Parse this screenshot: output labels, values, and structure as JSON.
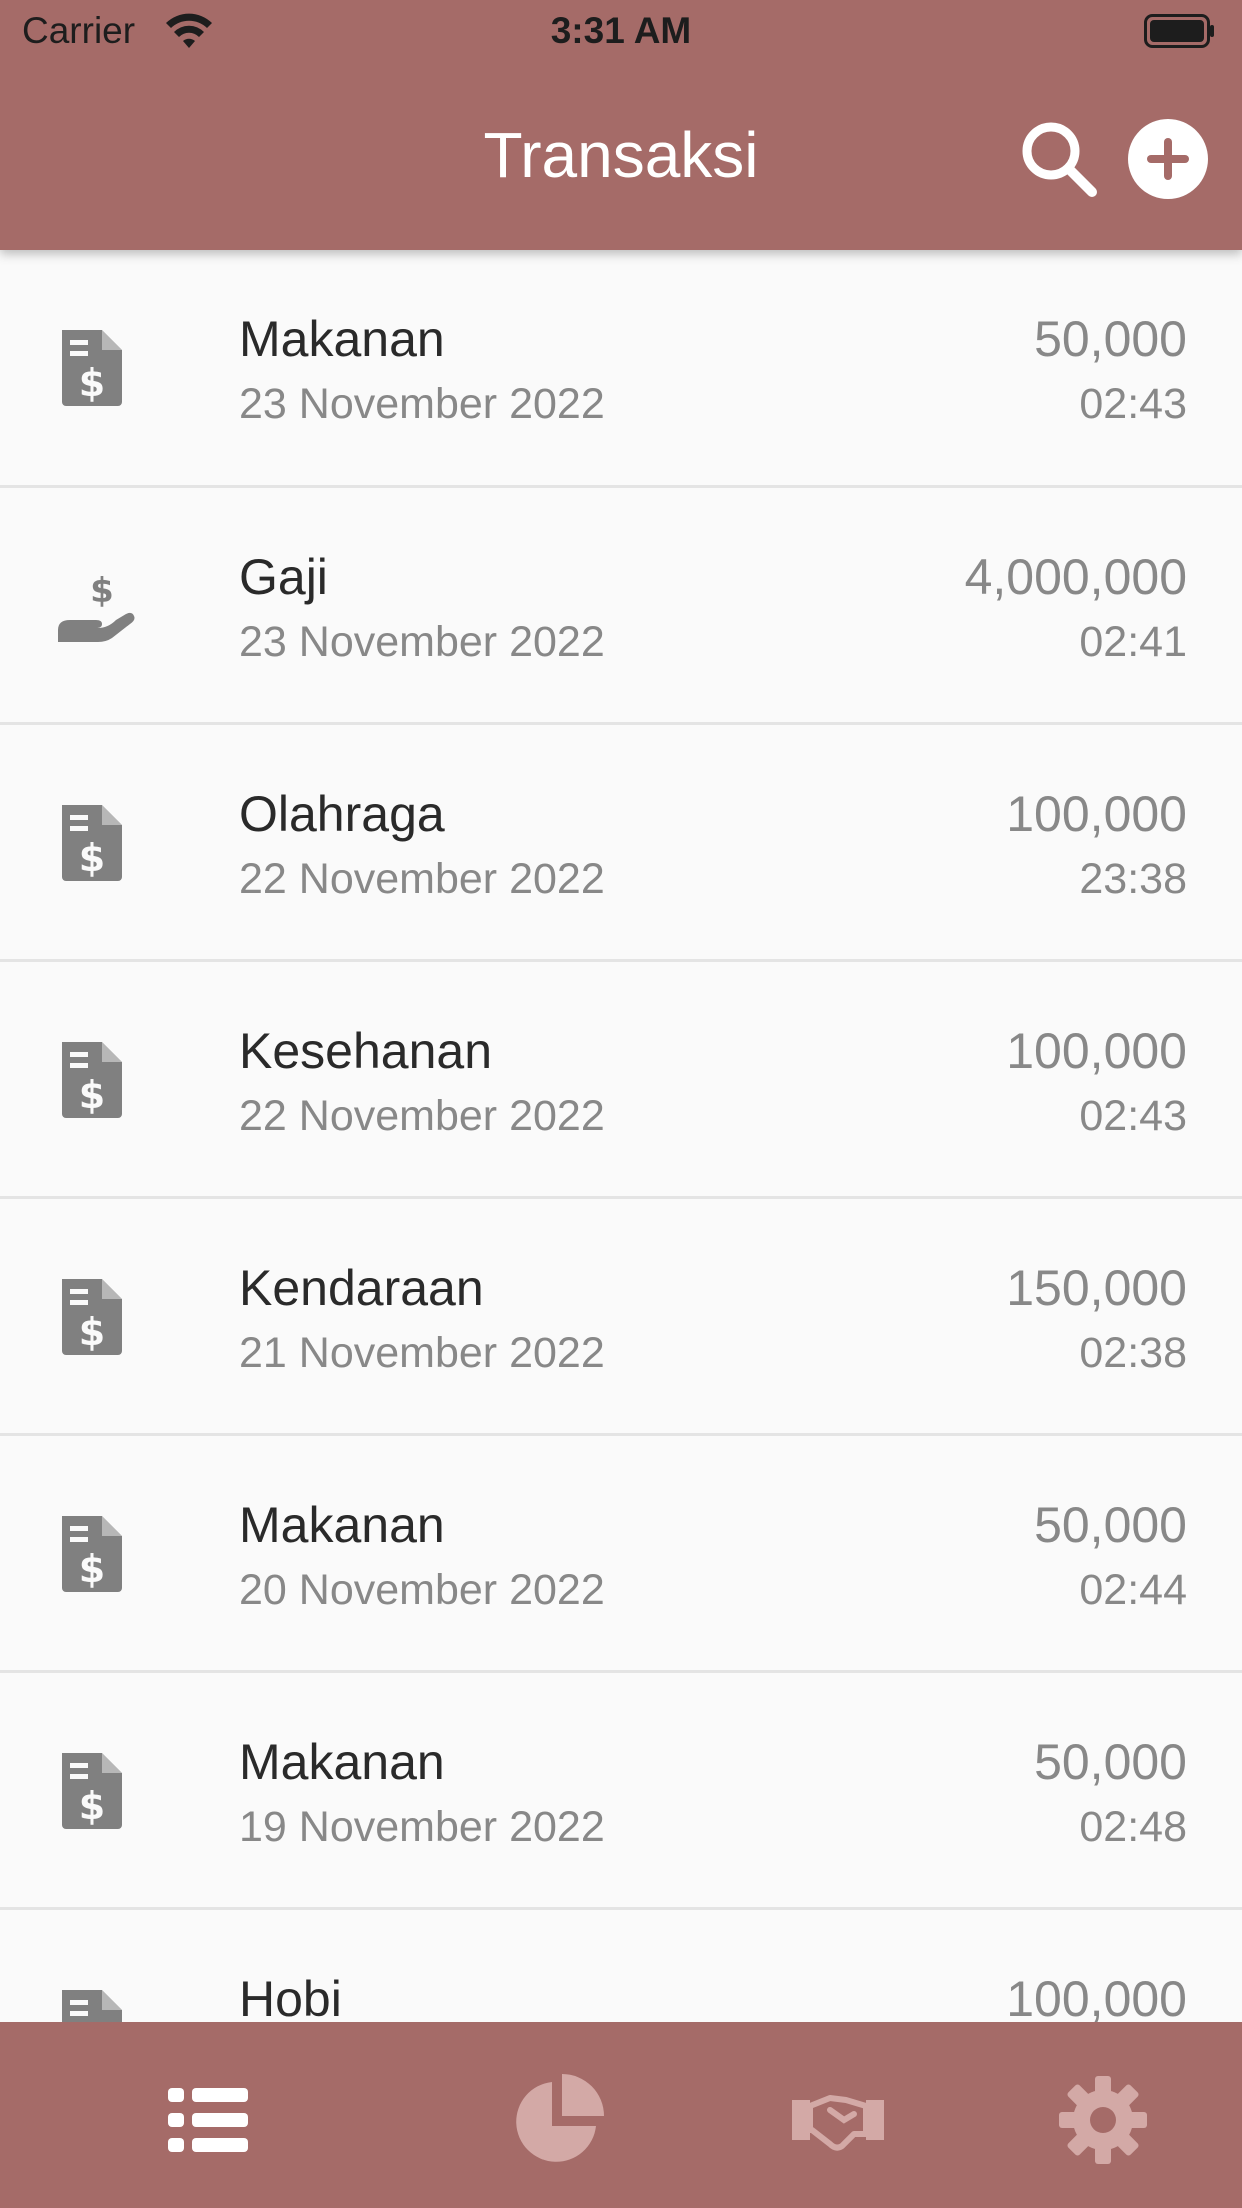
{
  "status_bar": {
    "carrier": "Carrier",
    "time": "3:31 AM"
  },
  "header": {
    "title": "Transaksi"
  },
  "colors": {
    "bar": "#a56b68",
    "icon": "#808080",
    "active_tab": "#ffffff",
    "inactive_tab": "#d3a9a6"
  },
  "transactions": [
    {
      "icon": "invoice-dollar-icon",
      "name": "Makanan",
      "date": "23 November 2022",
      "amount": "50,000",
      "time": "02:43"
    },
    {
      "icon": "hand-dollar-icon",
      "name": "Gaji",
      "date": "23 November 2022",
      "amount": "4,000,000",
      "time": "02:41"
    },
    {
      "icon": "invoice-dollar-icon",
      "name": "Olahraga",
      "date": "22 November 2022",
      "amount": "100,000",
      "time": "23:38"
    },
    {
      "icon": "invoice-dollar-icon",
      "name": "Kesehanan",
      "date": "22 November 2022",
      "amount": "100,000",
      "time": "02:43"
    },
    {
      "icon": "invoice-dollar-icon",
      "name": "Kendaraan",
      "date": "21 November 2022",
      "amount": "150,000",
      "time": "02:38"
    },
    {
      "icon": "invoice-dollar-icon",
      "name": "Makanan",
      "date": "20 November 2022",
      "amount": "50,000",
      "time": "02:44"
    },
    {
      "icon": "invoice-dollar-icon",
      "name": "Makanan",
      "date": "19 November 2022",
      "amount": "50,000",
      "time": "02:48"
    },
    {
      "icon": "invoice-dollar-icon",
      "name": "Hobi",
      "date": "",
      "amount": "100,000",
      "time": ""
    }
  ],
  "tabs": [
    {
      "icon": "list-icon",
      "active": true
    },
    {
      "icon": "pie-chart-icon",
      "active": false
    },
    {
      "icon": "handshake-icon",
      "active": false
    },
    {
      "icon": "gear-icon",
      "active": false
    }
  ]
}
